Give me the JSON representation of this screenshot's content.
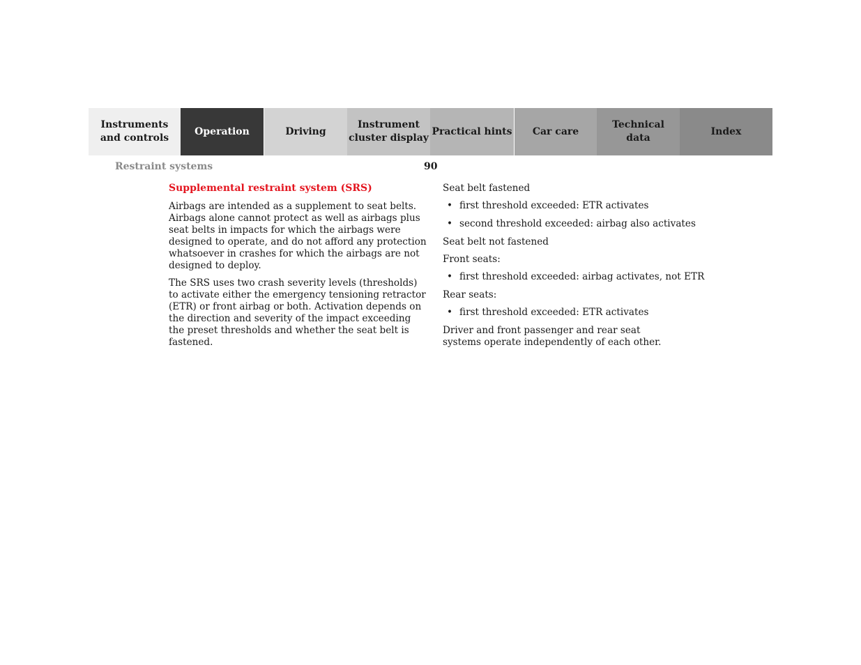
{
  "nav": {
    "tabs": [
      {
        "label": "Instruments\nand controls",
        "bg": "#efefef",
        "color": "#1a1a1a",
        "active": false
      },
      {
        "label": "Operation",
        "bg": "#383838",
        "color": "#ffffff",
        "active": true
      },
      {
        "label": "Driving",
        "bg": "#d3d3d3",
        "color": "#1a1a1a",
        "active": false
      },
      {
        "label": "Instrument\ncluster display",
        "bg": "#c3c3c3",
        "color": "#1a1a1a",
        "active": false
      },
      {
        "label": "Practical hints",
        "bg": "#b5b5b5",
        "color": "#1a1a1a",
        "active": false
      },
      {
        "label": "Car care",
        "bg": "#a6a6a6",
        "color": "#1a1a1a",
        "active": false
      },
      {
        "label": "Technical\ndata",
        "bg": "#979797",
        "color": "#1a1a1a",
        "active": false
      },
      {
        "label": "Index",
        "bg": "#8a8a8a",
        "color": "#1a1a1a",
        "active": false
      }
    ]
  },
  "header": {
    "section_title": "Restraint systems",
    "page_number": "90"
  },
  "left": {
    "heading": "Supplemental restraint system (SRS)",
    "paragraphs": [
      "Airbags are intended as a supplement to seat belts. Airbags alone cannot protect as well as airbags plus seat belts in impacts for which the airbags were designed to operate, and do not afford any protection whatsoever in crashes for which the airbags are not designed to deploy.",
      "The SRS uses two crash severity levels (thresholds) to activate either the emergency tensioning retractor (ETR) or front airbag or both. Activation depends on the direction and severity of the impact exceeding the preset thresholds and whether the seat belt is fastened."
    ]
  },
  "right": {
    "belt_fastened": "Seat belt fastened",
    "belt_fastened_items": [
      "first threshold exceeded: ETR activates",
      "second threshold exceeded: airbag also activates"
    ],
    "belt_not_fastened": "Seat belt not fastened",
    "front_seats": "Front seats:",
    "front_items": [
      "first threshold exceeded: airbag activates, not ETR"
    ],
    "rear_seats": "Rear seats:",
    "rear_items": [
      "first threshold exceeded: ETR activates"
    ],
    "closing": "Driver and front passenger and rear seat systems operate independently of each other.",
    "bullet_glyph": "•"
  }
}
